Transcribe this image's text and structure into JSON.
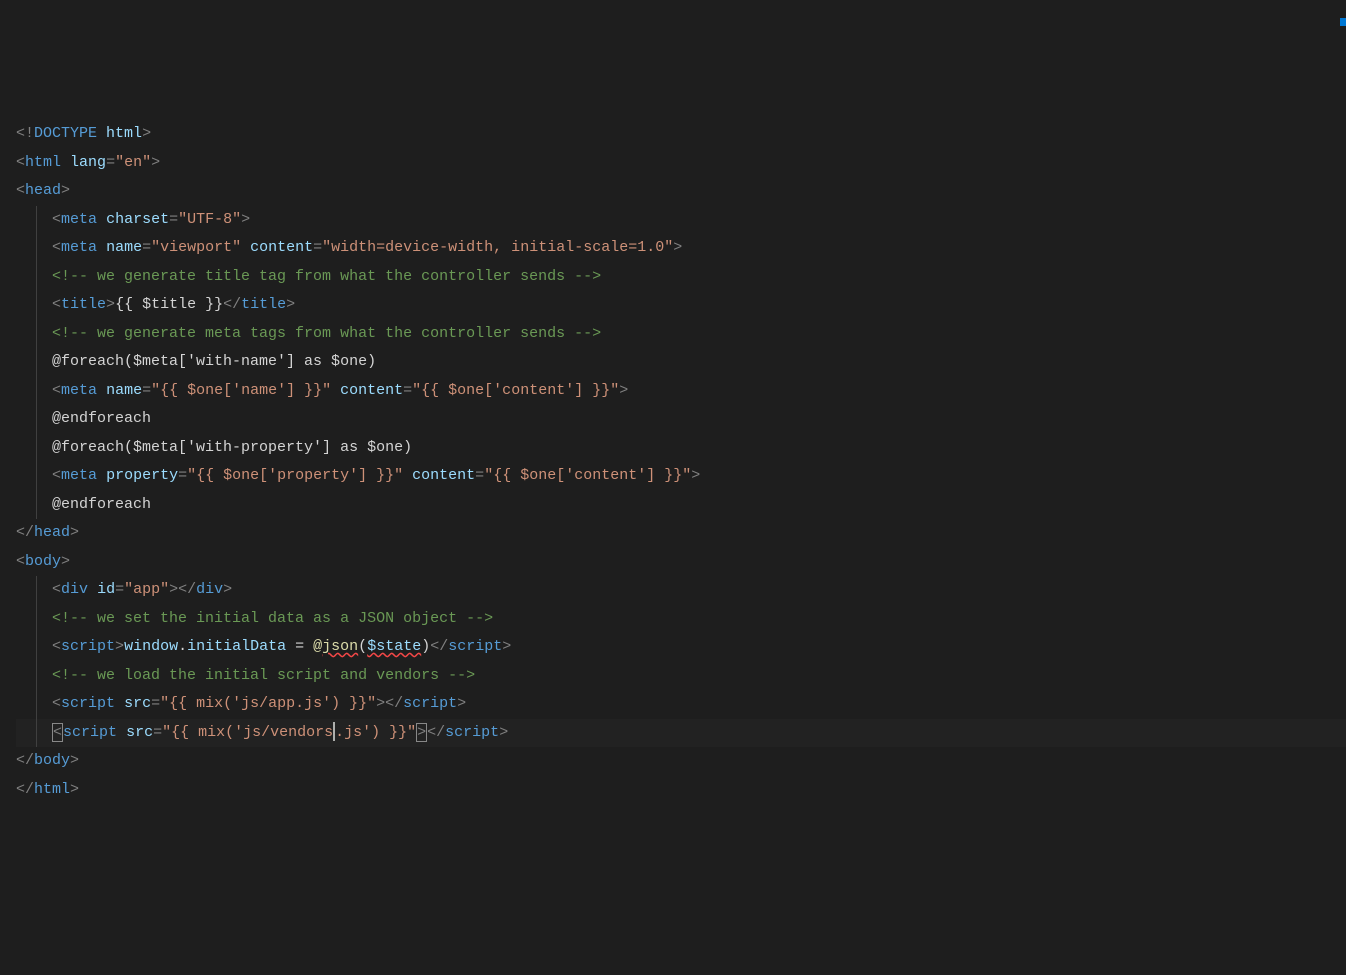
{
  "lines": [
    {
      "indent": 0,
      "tokens": [
        {
          "c": "br",
          "t": "<!"
        },
        {
          "c": "doctype",
          "t": "DOCTYPE"
        },
        {
          "c": "txt",
          "t": " "
        },
        {
          "c": "attr",
          "t": "html"
        },
        {
          "c": "br",
          "t": ">"
        }
      ]
    },
    {
      "indent": 0,
      "tokens": [
        {
          "c": "br",
          "t": "<"
        },
        {
          "c": "tag",
          "t": "html"
        },
        {
          "c": "txt",
          "t": " "
        },
        {
          "c": "attr",
          "t": "lang"
        },
        {
          "c": "br",
          "t": "="
        },
        {
          "c": "str",
          "t": "\"en\""
        },
        {
          "c": "br",
          "t": ">"
        }
      ]
    },
    {
      "indent": 0,
      "tokens": [
        {
          "c": "br",
          "t": "<"
        },
        {
          "c": "tag",
          "t": "head"
        },
        {
          "c": "br",
          "t": ">"
        }
      ]
    },
    {
      "indent": 1,
      "guides": [
        0
      ],
      "tokens": [
        {
          "c": "br",
          "t": "<"
        },
        {
          "c": "tag",
          "t": "meta"
        },
        {
          "c": "txt",
          "t": " "
        },
        {
          "c": "attr",
          "t": "charset"
        },
        {
          "c": "br",
          "t": "="
        },
        {
          "c": "str",
          "t": "\"UTF-8\""
        },
        {
          "c": "br",
          "t": ">"
        }
      ]
    },
    {
      "indent": 1,
      "guides": [
        0
      ],
      "tokens": [
        {
          "c": "br",
          "t": "<"
        },
        {
          "c": "tag",
          "t": "meta"
        },
        {
          "c": "txt",
          "t": " "
        },
        {
          "c": "attr",
          "t": "name"
        },
        {
          "c": "br",
          "t": "="
        },
        {
          "c": "str",
          "t": "\"viewport\""
        },
        {
          "c": "txt",
          "t": " "
        },
        {
          "c": "attr",
          "t": "content"
        },
        {
          "c": "br",
          "t": "="
        },
        {
          "c": "str",
          "t": "\"width=device-width, initial-scale=1.0\""
        },
        {
          "c": "br",
          "t": ">"
        }
      ]
    },
    {
      "indent": 1,
      "guides": [
        0
      ],
      "tokens": [
        {
          "c": "cmt",
          "t": "<!-- we generate title tag from what the controller sends -->"
        }
      ]
    },
    {
      "indent": 1,
      "guides": [
        0
      ],
      "tokens": [
        {
          "c": "br",
          "t": "<"
        },
        {
          "c": "tag",
          "t": "title"
        },
        {
          "c": "br",
          "t": ">"
        },
        {
          "c": "txt",
          "t": "{{ $title }}"
        },
        {
          "c": "br",
          "t": "</"
        },
        {
          "c": "tag",
          "t": "title"
        },
        {
          "c": "br",
          "t": ">"
        }
      ]
    },
    {
      "indent": 1,
      "guides": [
        0
      ],
      "tokens": [
        {
          "c": "cmt",
          "t": "<!-- we generate meta tags from what the controller sends -->"
        }
      ]
    },
    {
      "indent": 1,
      "guides": [
        0
      ],
      "tokens": [
        {
          "c": "txt",
          "t": "@foreach($meta['with-name'] as $one)"
        }
      ]
    },
    {
      "indent": 1,
      "guides": [
        0
      ],
      "tokens": [
        {
          "c": "br",
          "t": "<"
        },
        {
          "c": "tag",
          "t": "meta"
        },
        {
          "c": "txt",
          "t": " "
        },
        {
          "c": "attr",
          "t": "name"
        },
        {
          "c": "br",
          "t": "="
        },
        {
          "c": "str",
          "t": "\"{{ $one['name'] }}\""
        },
        {
          "c": "txt",
          "t": " "
        },
        {
          "c": "attr",
          "t": "content"
        },
        {
          "c": "br",
          "t": "="
        },
        {
          "c": "str",
          "t": "\"{{ $one['content'] }}\""
        },
        {
          "c": "br",
          "t": ">"
        }
      ]
    },
    {
      "indent": 1,
      "guides": [
        0
      ],
      "tokens": [
        {
          "c": "txt",
          "t": "@endforeach"
        }
      ]
    },
    {
      "indent": 1,
      "guides": [
        0
      ],
      "tokens": [
        {
          "c": "txt",
          "t": "@foreach($meta['with-property'] as $one)"
        }
      ]
    },
    {
      "indent": 1,
      "guides": [
        0
      ],
      "tokens": [
        {
          "c": "br",
          "t": "<"
        },
        {
          "c": "tag",
          "t": "meta"
        },
        {
          "c": "txt",
          "t": " "
        },
        {
          "c": "attr",
          "t": "property"
        },
        {
          "c": "br",
          "t": "="
        },
        {
          "c": "str",
          "t": "\"{{ $one['property'] }}\""
        },
        {
          "c": "txt",
          "t": " "
        },
        {
          "c": "attr",
          "t": "content"
        },
        {
          "c": "br",
          "t": "="
        },
        {
          "c": "str",
          "t": "\"{{ $one['content'] }}\""
        },
        {
          "c": "br",
          "t": ">"
        }
      ]
    },
    {
      "indent": 1,
      "guides": [
        0
      ],
      "tokens": [
        {
          "c": "txt",
          "t": "@endforeach"
        }
      ]
    },
    {
      "indent": 0,
      "tokens": [
        {
          "c": "br",
          "t": "</"
        },
        {
          "c": "tag",
          "t": "head"
        },
        {
          "c": "br",
          "t": ">"
        }
      ]
    },
    {
      "indent": 0,
      "tokens": [
        {
          "c": "br",
          "t": "<"
        },
        {
          "c": "tag",
          "t": "body"
        },
        {
          "c": "br",
          "t": ">"
        }
      ]
    },
    {
      "indent": 1,
      "guides": [
        0
      ],
      "tokens": [
        {
          "c": "br",
          "t": "<"
        },
        {
          "c": "tag",
          "t": "div"
        },
        {
          "c": "txt",
          "t": " "
        },
        {
          "c": "attr",
          "t": "id"
        },
        {
          "c": "br",
          "t": "="
        },
        {
          "c": "str",
          "t": "\"app\""
        },
        {
          "c": "br",
          "t": "></"
        },
        {
          "c": "tag",
          "t": "div"
        },
        {
          "c": "br",
          "t": ">"
        }
      ]
    },
    {
      "indent": 1,
      "guides": [
        0
      ],
      "tokens": [
        {
          "c": "cmt",
          "t": "<!-- we set the initial data as a JSON object -->"
        }
      ]
    },
    {
      "indent": 1,
      "guides": [
        0
      ],
      "tokens": [
        {
          "c": "br",
          "t": "<"
        },
        {
          "c": "tag",
          "t": "script"
        },
        {
          "c": "br",
          "t": ">"
        },
        {
          "c": "var",
          "t": "window"
        },
        {
          "c": "txt",
          "t": "."
        },
        {
          "c": "var",
          "t": "initialData"
        },
        {
          "c": "txt",
          "t": " = "
        },
        {
          "c": "fn",
          "t": "@"
        },
        {
          "c": "fn",
          "t": "json",
          "err": true
        },
        {
          "c": "txt",
          "t": "("
        },
        {
          "c": "var",
          "t": "$state",
          "err": true
        },
        {
          "c": "txt",
          "t": ")"
        },
        {
          "c": "br",
          "t": "</"
        },
        {
          "c": "tag",
          "t": "script"
        },
        {
          "c": "br",
          "t": ">"
        }
      ]
    },
    {
      "indent": 1,
      "guides": [
        0
      ],
      "tokens": [
        {
          "c": "cmt",
          "t": "<!-- we load the initial script and vendors -->"
        }
      ]
    },
    {
      "indent": 1,
      "guides": [
        0
      ],
      "tokens": [
        {
          "c": "br",
          "t": "<"
        },
        {
          "c": "tag",
          "t": "script"
        },
        {
          "c": "txt",
          "t": " "
        },
        {
          "c": "attr",
          "t": "src"
        },
        {
          "c": "br",
          "t": "="
        },
        {
          "c": "str",
          "t": "\"{{ mix('js/app.js') }}\""
        },
        {
          "c": "br",
          "t": "></"
        },
        {
          "c": "tag",
          "t": "script"
        },
        {
          "c": "br",
          "t": ">"
        }
      ]
    },
    {
      "indent": 1,
      "guides": [
        0
      ],
      "active": true,
      "cursor": true,
      "tokens": [
        {
          "c": "br",
          "t": "<",
          "box": true
        },
        {
          "c": "tag",
          "t": "script"
        },
        {
          "c": "txt",
          "t": " "
        },
        {
          "c": "attr",
          "t": "src"
        },
        {
          "c": "br",
          "t": "="
        },
        {
          "c": "str",
          "t": "\"{{ mix('js/vendors"
        },
        {
          "c": "str",
          "t": ".js') }}\"",
          "cursorBefore": true
        },
        {
          "c": "br",
          "t": ">",
          "box": true
        },
        {
          "c": "br",
          "t": "</"
        },
        {
          "c": "tag",
          "t": "script"
        },
        {
          "c": "br",
          "t": ">"
        }
      ]
    },
    {
      "indent": 0,
      "tokens": [
        {
          "c": "br",
          "t": "</"
        },
        {
          "c": "tag",
          "t": "body"
        },
        {
          "c": "br",
          "t": ">"
        }
      ]
    },
    {
      "indent": 0,
      "tokens": [
        {
          "c": "br",
          "t": "</"
        },
        {
          "c": "tag",
          "t": "html"
        },
        {
          "c": "br",
          "t": ">"
        }
      ]
    }
  ]
}
